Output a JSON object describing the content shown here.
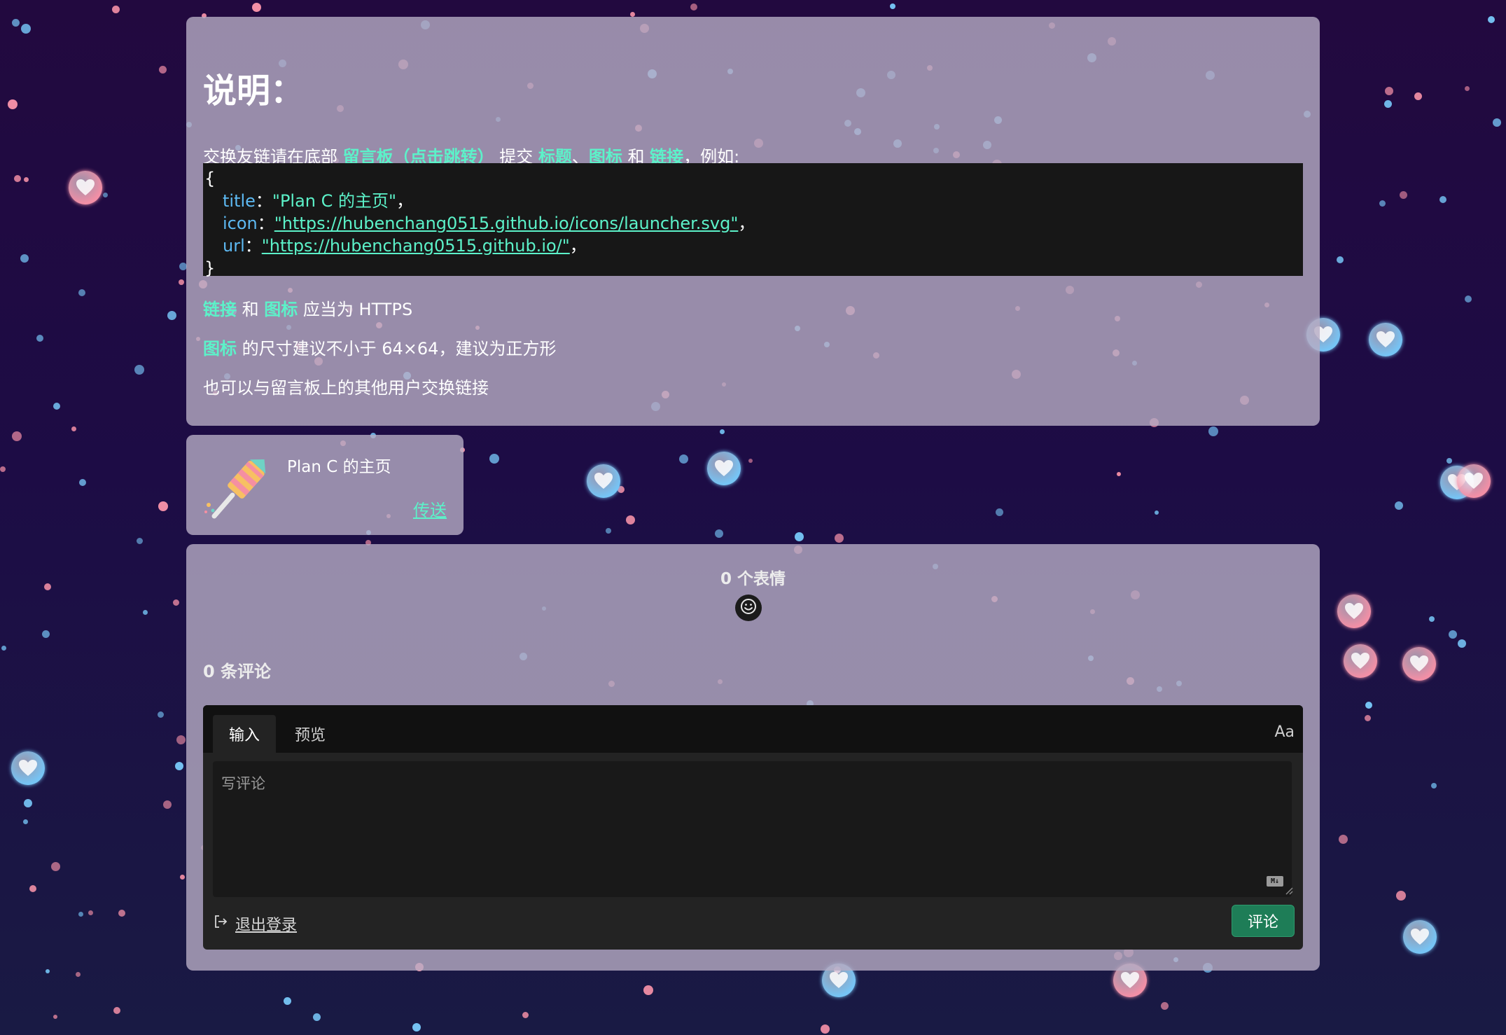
{
  "colors": {
    "background": "#22093f",
    "panel": "#b6acc4",
    "accent": "#5cf2c9",
    "code_key": "#5db9f2",
    "submit": "#1e7d57",
    "heart_pink": "#f28fa6",
    "heart_blue": "#76c4f5"
  },
  "info": {
    "title": "说明：",
    "intro": {
      "prefix": "交换友链请在底部 ",
      "board_link": "留言板（点击跳转）",
      "submit": " 提交 ",
      "title_word": "标题",
      "sep": "、",
      "icon_word": "图标",
      "and": " 和 ",
      "link_word": "链接",
      "suffix": "，例如:"
    },
    "code": {
      "open": "{",
      "title_key": "title",
      "title_value": "\"Plan C 的主页\"",
      "icon_key": "icon",
      "icon_value": "\"https://hubenchang0515.github.io/icons/launcher.svg\"",
      "url_key": "url",
      "url_value": "\"https://hubenchang0515.github.io/\"",
      "colon": "：",
      "comma": "，",
      "close": "}"
    },
    "line1": {
      "a": "链接",
      "and": " 和 ",
      "b": "图标",
      "rest": " 应当为 HTTPS"
    },
    "line2": {
      "a": "图标",
      "rest": " 的尺寸建议不小于 64×64，建议为正方形"
    },
    "line3": "也可以与留言板上的其他用户交换链接"
  },
  "friend_link": {
    "icon": "rocket-launcher-icon",
    "title": "Plan C 的主页",
    "go_label": "传送"
  },
  "comments": {
    "reaction_count": "0 个表情",
    "emoji_icon": "smile-icon",
    "comment_count": "0 条评论",
    "tab_write": "输入",
    "tab_preview": "预览",
    "font_toggle": "Aa",
    "placeholder": "写评论",
    "markdown_badge": "M↓",
    "logout_icon": "sign-out-icon",
    "logout": "退出登录",
    "submit": "评论"
  }
}
